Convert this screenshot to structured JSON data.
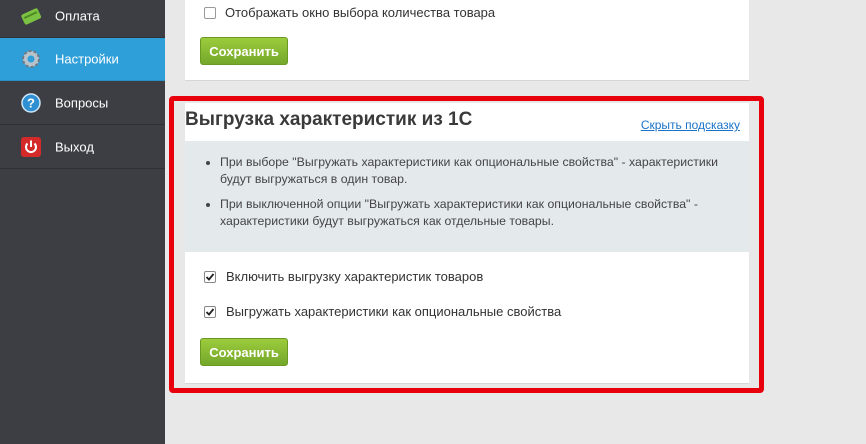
{
  "sidebar": {
    "items": [
      {
        "label": "Оплата",
        "icon": "payment-icon"
      },
      {
        "label": "Настройки",
        "icon": "settings-gear-icon",
        "active": true
      },
      {
        "label": "Вопросы",
        "icon": "question-icon"
      },
      {
        "label": "Выход",
        "icon": "power-icon"
      }
    ]
  },
  "top_section": {
    "checkbox_label": "Отображать окно выбора количества товара",
    "checkbox_checked": false,
    "save_label": "Сохранить"
  },
  "export_section": {
    "title": "Выгрузка характеристик из 1С",
    "hint_link": "Скрыть подсказку",
    "hints": [
      "При выборе \"Выгружать характеристики как опциональные свойства\" - характеристики будут выгружаться в один товар.",
      "При выключенной опции \"Выгружать характеристики как опциональные свойства\" - характеристики будут выгружаться как отдельные товары."
    ],
    "options": [
      {
        "label": "Включить выгрузку характеристик товаров",
        "checked": true
      },
      {
        "label": "Выгружать характеристики как опциональные свойства",
        "checked": true
      }
    ],
    "save_label": "Сохранить"
  },
  "colors": {
    "sidebar_bg": "#3c3e44",
    "active_item": "#2f9fd9",
    "save_button": "#8bbd35",
    "highlight_border": "#e8000d",
    "link": "#1a73c8"
  }
}
